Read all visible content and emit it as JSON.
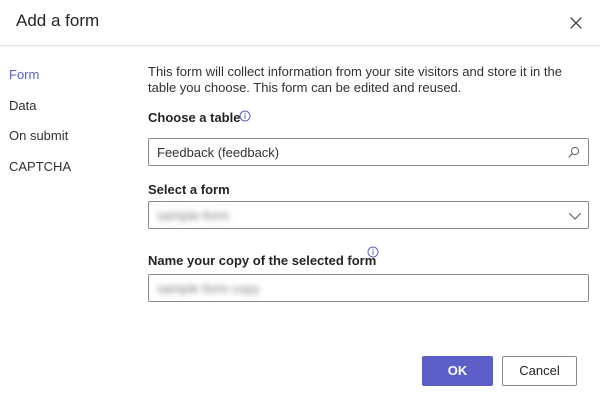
{
  "dialog": {
    "title": "Add a form"
  },
  "nav": {
    "items": [
      {
        "label": "Form",
        "active": true
      },
      {
        "label": "Data",
        "active": false
      },
      {
        "label": "On submit",
        "active": false
      },
      {
        "label": "CAPTCHA",
        "active": false
      }
    ]
  },
  "form": {
    "description": "This form will collect information from your site visitors and store it in the table you choose. This form can be edited and reused.",
    "table": {
      "label": "Choose a table",
      "value": "Feedback (feedback)"
    },
    "select_form": {
      "label": "Select a form",
      "value": "sample-form"
    },
    "copy_name": {
      "label": "Name your copy of the selected form",
      "value": "sample form copy"
    }
  },
  "buttons": {
    "ok": "OK",
    "cancel": "Cancel"
  },
  "colors": {
    "accent": "#5b5fc7",
    "border": "#8a8886"
  },
  "icons": {
    "close": "close-icon",
    "info": "info-icon",
    "search": "search-icon",
    "chevron": "chevron-down-icon"
  }
}
